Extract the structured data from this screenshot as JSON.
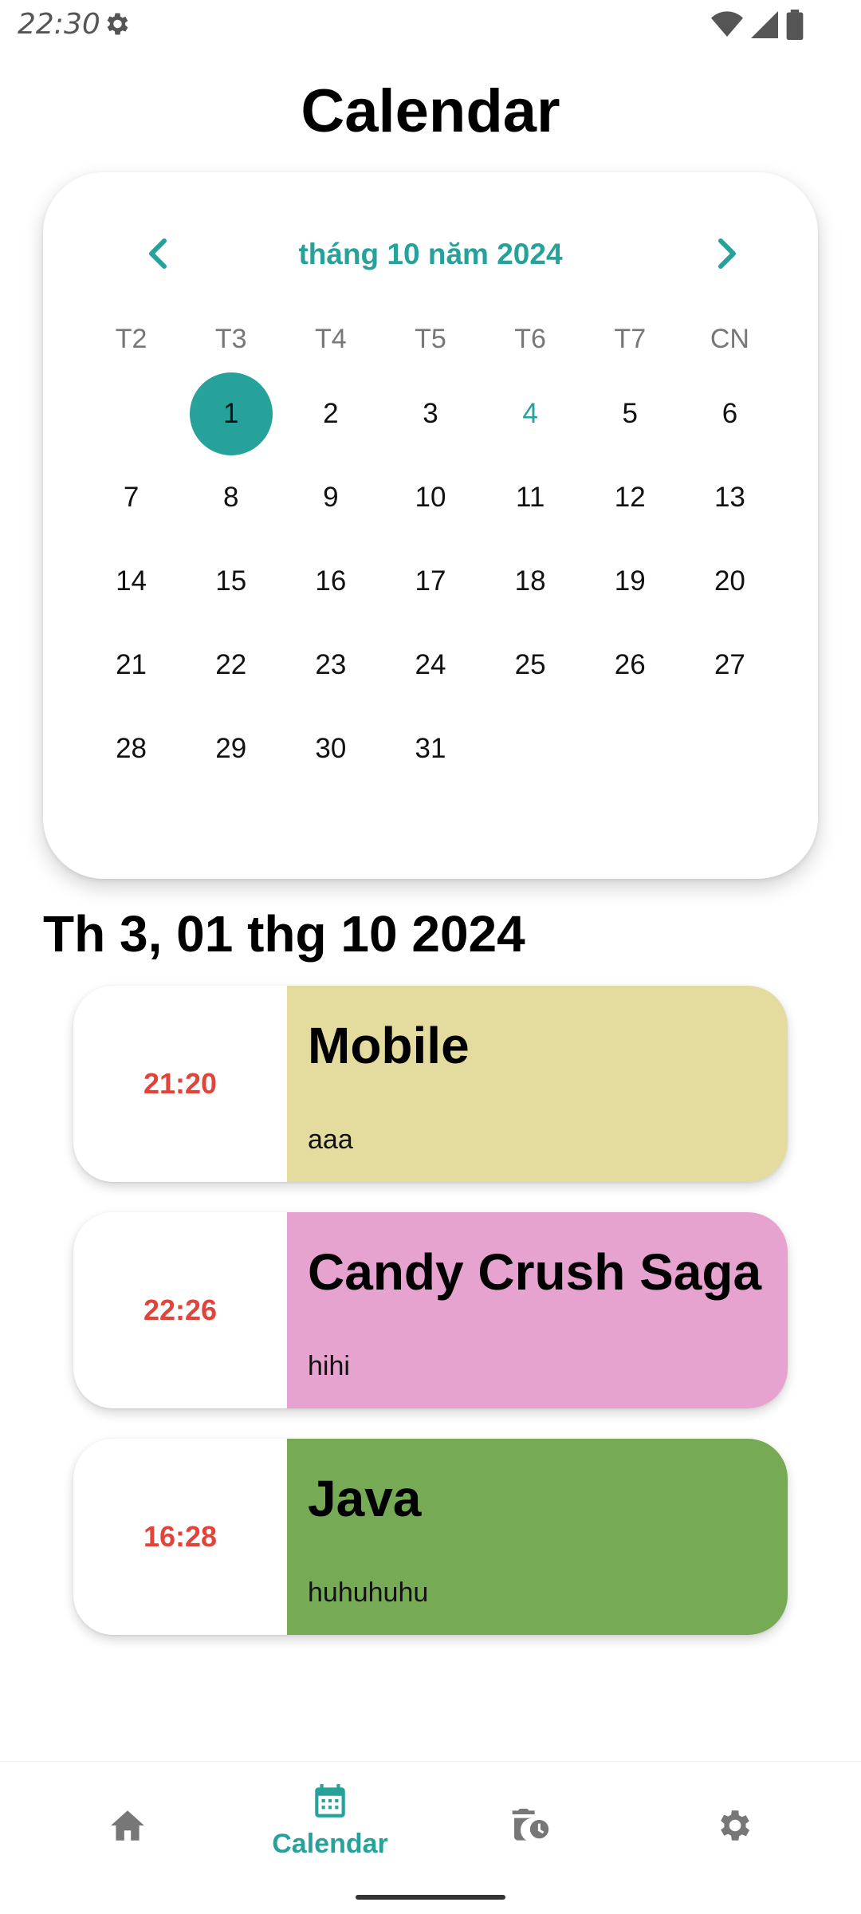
{
  "status_bar": {
    "time": "22:30"
  },
  "title": "Calendar",
  "calendar": {
    "month_label": "tháng 10 năm 2024",
    "weekdays": [
      "T2",
      "T3",
      "T4",
      "T5",
      "T6",
      "T7",
      "CN"
    ],
    "leading_blanks": 1,
    "days": [
      "1",
      "2",
      "3",
      "4",
      "5",
      "6",
      "7",
      "8",
      "9",
      "10",
      "11",
      "12",
      "13",
      "14",
      "15",
      "16",
      "17",
      "18",
      "19",
      "20",
      "21",
      "22",
      "23",
      "24",
      "25",
      "26",
      "27",
      "28",
      "29",
      "30",
      "31"
    ],
    "selected_day": "1",
    "today": "4",
    "accent_color": "#26a29b"
  },
  "selected_date_label": "Th 3, 01 thg 10 2024",
  "events": [
    {
      "time": "21:20",
      "title": "Mobile",
      "description": "aaa",
      "color": "#e4dc9e"
    },
    {
      "time": "22:26",
      "title": "Candy Crush Saga",
      "description": "hihi",
      "color": "#e6a3cf"
    },
    {
      "time": "16:28",
      "title": "Java",
      "description": "huhuhuhu",
      "color": "#76aa55"
    }
  ],
  "bottom_nav": {
    "items": [
      {
        "icon": "home-icon",
        "label": ""
      },
      {
        "icon": "calendar-icon",
        "label": "Calendar",
        "active": true
      },
      {
        "icon": "history-icon",
        "label": ""
      },
      {
        "icon": "gear-icon",
        "label": ""
      }
    ]
  }
}
